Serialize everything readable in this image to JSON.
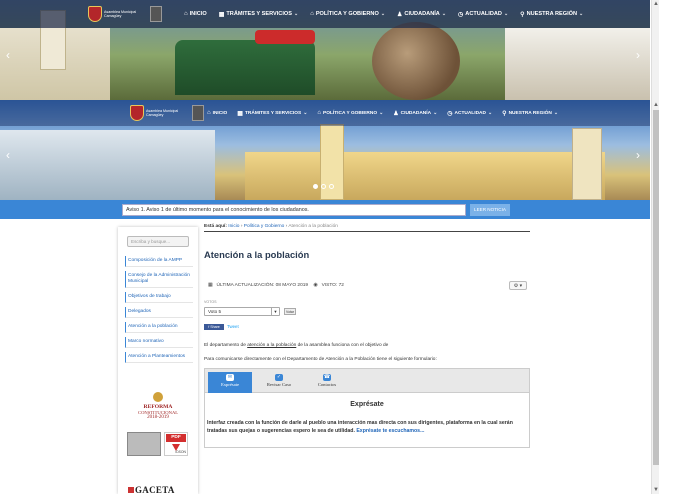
{
  "site": {
    "logo_text": "Asamblea Municipal Camagüey"
  },
  "nav": {
    "items": [
      {
        "label": "INICIO",
        "icon": "home-icon"
      },
      {
        "label": "TRÁMITES Y SERVICIOS",
        "icon": "grid-icon"
      },
      {
        "label": "POLÍTICA Y GOBIERNO",
        "icon": "building-icon"
      },
      {
        "label": "CIUDADANÍA",
        "icon": "users-icon"
      },
      {
        "label": "ACTUALIDAD",
        "icon": "clock-icon"
      },
      {
        "label": "NUESTRA REGIÓN",
        "icon": "map-pin-icon"
      }
    ]
  },
  "notice": {
    "text": "Aviso 1. Aviso 1 de último momento para el conocimiento de los ciudadanos.",
    "button": "LEER NOTICIA"
  },
  "sidebar": {
    "search_placeholder": "Escriba y busque...",
    "items": [
      "Composición de la AMPP",
      "Consejo de la Administración Municipal",
      "Objetivos de trabajo",
      "Delegados",
      "Atención a la población",
      "Marco normativo",
      "Atención a Planteamientos"
    ],
    "reform": {
      "line1": "REFORMA",
      "line2": "CONSTITUCIONAL",
      "line3": "2018-2019"
    },
    "pdf_label": "PDF",
    "pdf_sub": "iDSON",
    "gaceta": "GACETA"
  },
  "main": {
    "breadcrumb": {
      "label": "Está aquí:",
      "items": [
        "Inicio",
        "Política y Gobierno"
      ],
      "current": "Atención a la población"
    },
    "title": "Atención a la población",
    "meta": {
      "updated": "ÚLTIMA ACTUALIZACIÓN: 08 MAYO 2019",
      "views": "VISTO: 72"
    },
    "vote": {
      "label": "VOTOS",
      "selected": "Voto 5",
      "button": "Votar"
    },
    "share": {
      "facebook": "f Share",
      "twitter": "Tweet"
    },
    "p1_start": "El departamento de ",
    "p1_underlined": "atención a la población",
    "p1_end": " de la asamblea funciona con el objetivo de",
    "p2": "Para comunicarse directamente con el Departamento de Atención a la Población tiene el siguiente formulario:",
    "form": {
      "tabs": [
        {
          "label": "Exprésate",
          "icon": "chat-icon",
          "active": true
        },
        {
          "label": "Revisar Caso",
          "icon": "check-icon",
          "active": false
        },
        {
          "label": "Contactos",
          "icon": "phone-icon",
          "active": false
        }
      ],
      "heading": "Exprésate",
      "paragraph": "Interfaz creada con la función de darle al pueblo una interacción mas directa con sus dirigentes, plataforma en la cual serán tratadas sus quejas o sugerencias espero le sea de utilidad. ",
      "link": "Exprésate te escuchamos..."
    }
  }
}
